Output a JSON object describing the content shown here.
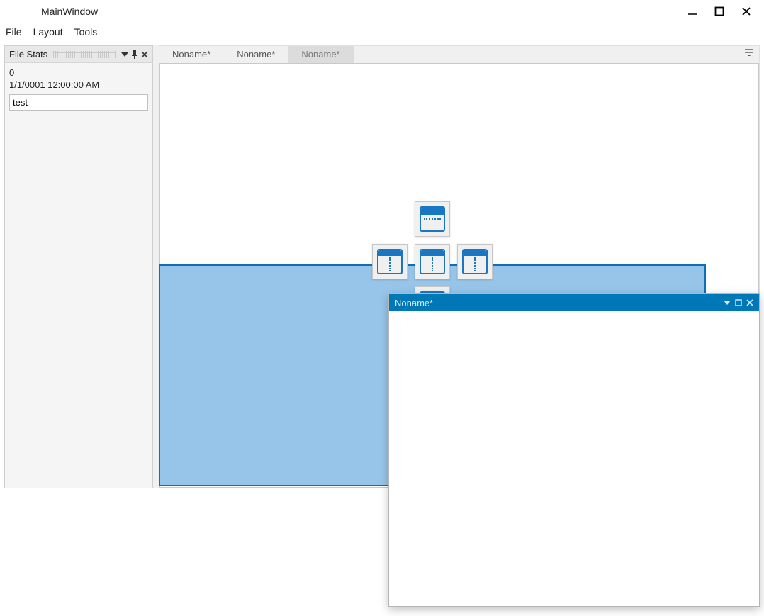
{
  "window": {
    "title": "MainWindow"
  },
  "menu": {
    "items": [
      "File",
      "Layout",
      "Tools"
    ]
  },
  "panel": {
    "title": "File Stats",
    "stats": {
      "count": "0",
      "timestamp": "1/1/0001 12:00:00 AM"
    },
    "input_value": "test"
  },
  "tabs": [
    {
      "label": "Noname*",
      "active": false
    },
    {
      "label": "Noname*",
      "active": false
    },
    {
      "label": "Noname*",
      "active": true
    }
  ],
  "floating": {
    "title": "Noname*"
  },
  "icons": {
    "dropdown": "▼",
    "pin": "⬛",
    "close": "✕",
    "minimize": "—",
    "maximize": "□",
    "tablist": "≡"
  }
}
